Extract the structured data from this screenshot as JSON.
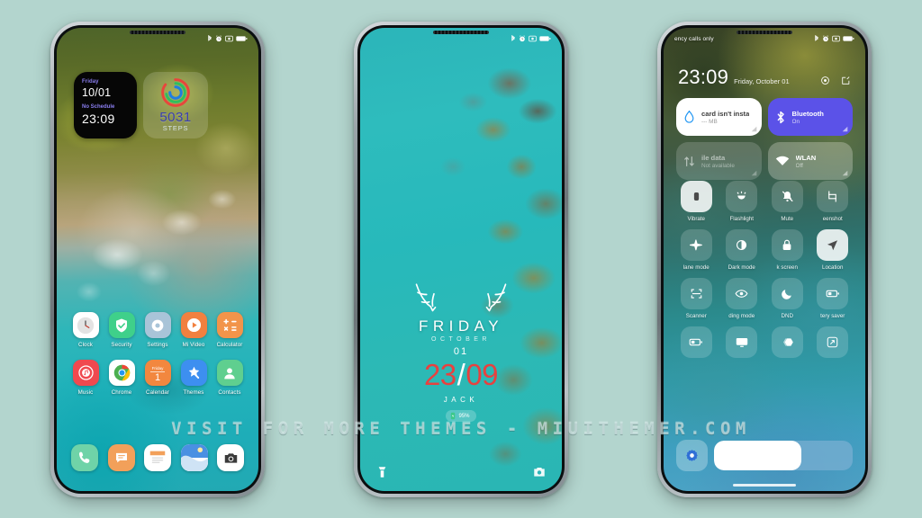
{
  "page": {
    "background_color": "#b3d5ce",
    "watermark": "VISIT FOR MORE THEMES - MIUITHEMER.COM"
  },
  "phone_left": {
    "name": "home-screen",
    "statusbar": {
      "left_text": "",
      "icons": [
        "bluetooth-icon",
        "alarm-icon",
        "screenshot-icon",
        "battery-icon"
      ]
    },
    "clock_widget": {
      "weekday": "Friday",
      "date": "10/01",
      "schedule": "No Schedule",
      "time": "23:09",
      "label_color": "#8a7ef0",
      "background_color": "#060606"
    },
    "steps_widget": {
      "count": "5031",
      "unit": "STEPS",
      "ring_colors": [
        "#e8453c",
        "#2fbf5f",
        "#1f7fe0"
      ],
      "count_color": "#3a3fb0"
    },
    "apps": [
      {
        "label": "Clock",
        "icon": "clock-icon",
        "bg": "#ffffff"
      },
      {
        "label": "Security",
        "icon": "shield-icon",
        "bg": "#3fd08a"
      },
      {
        "label": "Settings",
        "icon": "settings-icon",
        "bg": "#a9c4d8"
      },
      {
        "label": "Mi Video",
        "icon": "play-icon",
        "bg": "#f2803f"
      },
      {
        "label": "Calculator",
        "icon": "calculator-icon",
        "bg": "#f2944a"
      },
      {
        "label": "Music",
        "icon": "music-icon",
        "bg": "#f0494f"
      },
      {
        "label": "Chrome",
        "icon": "chrome-icon",
        "bg": "#ffffff"
      },
      {
        "label": "Calendar",
        "icon": "calendar-icon",
        "bg": "#f2873f"
      },
      {
        "label": "Themes",
        "icon": "themes-icon",
        "bg": "#3d8ff0"
      },
      {
        "label": "Contacts",
        "icon": "contacts-icon",
        "bg": "#5fcf8f"
      }
    ],
    "calendar_icon": {
      "weekday": "Friday",
      "day": "1"
    },
    "dock": [
      {
        "label": "Phone",
        "icon": "phone-icon",
        "bg": "#6fd3a8"
      },
      {
        "label": "Messaging",
        "icon": "message-icon",
        "bg": "#f2a05a"
      },
      {
        "label": "Notes",
        "icon": "notes-icon",
        "bg": "#ffffff"
      },
      {
        "label": "Gallery",
        "icon": "gallery-icon",
        "bg": "#ffffff"
      },
      {
        "label": "Camera",
        "icon": "camera-icon",
        "bg": "#ffffff"
      }
    ]
  },
  "phone_mid": {
    "name": "lock-screen",
    "statusbar": {
      "icons": [
        "bluetooth-icon",
        "alarm-icon",
        "screenshot-icon",
        "battery-icon"
      ]
    },
    "weekday": "FRIDAY",
    "month": "OCTOBER",
    "day": "01",
    "time_hours": "23",
    "time_separator": "/",
    "time_minutes": "09",
    "owner": "JACK",
    "battery": "95%",
    "time_color": "#e8413f",
    "shortcuts": [
      {
        "label": "Flashlight",
        "icon": "flashlight-icon"
      },
      {
        "label": "Camera",
        "icon": "camera-icon"
      }
    ]
  },
  "phone_right": {
    "name": "control-center",
    "statusbar": {
      "left_text": "ency calls only",
      "icons": [
        "bluetooth-icon",
        "alarm-icon",
        "screenshot-icon",
        "battery-icon"
      ]
    },
    "header": {
      "time": "23:09",
      "date": "Friday, October 01",
      "icons": [
        "settings-gear-icon",
        "edit-icon"
      ]
    },
    "big_tiles": [
      {
        "title": "card isn't insta",
        "sub": "--- MB",
        "icon": "data-drop-icon",
        "state": "white"
      },
      {
        "title": "Bluetooth",
        "sub": "On",
        "icon": "bluetooth-icon",
        "state": "blue"
      },
      {
        "title": "ile data",
        "sub": "Not available",
        "icon": "mobile-data-icon",
        "state": "dim"
      },
      {
        "title": "WLAN",
        "sub": "Off",
        "icon": "wifi-icon",
        "state": "dim2"
      }
    ],
    "toggles": [
      {
        "label": "Vibrate",
        "icon": "vibrate-icon",
        "on": true
      },
      {
        "label": "Flashlight",
        "icon": "flashlight-icon",
        "on": false
      },
      {
        "label": "Mute",
        "icon": "mute-icon",
        "on": false
      },
      {
        "label": "eenshot",
        "icon": "screenshot-icon",
        "on": false
      },
      {
        "label": "lane mode",
        "icon": "airplane-icon",
        "on": false
      },
      {
        "label": "Dark mode",
        "icon": "darkmode-icon",
        "on": false
      },
      {
        "label": "k screen",
        "icon": "lock-icon",
        "on": false
      },
      {
        "label": "Location",
        "icon": "location-icon",
        "on": true
      },
      {
        "label": "Scanner",
        "icon": "scanner-icon",
        "on": false
      },
      {
        "label": "ding mode",
        "icon": "eye-icon",
        "on": false
      },
      {
        "label": "DND",
        "icon": "moon-icon",
        "on": false
      },
      {
        "label": "tery saver",
        "icon": "battery-saver-icon",
        "on": false
      },
      {
        "label": "",
        "icon": "power-icon",
        "on": false
      },
      {
        "label": "",
        "icon": "cast-icon",
        "on": false
      },
      {
        "label": "",
        "icon": "sync-icon",
        "on": false
      },
      {
        "label": "",
        "icon": "expand-icon",
        "on": false
      }
    ],
    "bottom": {
      "settings_icon": "settings-gear-icon",
      "brightness_percent": 63
    }
  }
}
